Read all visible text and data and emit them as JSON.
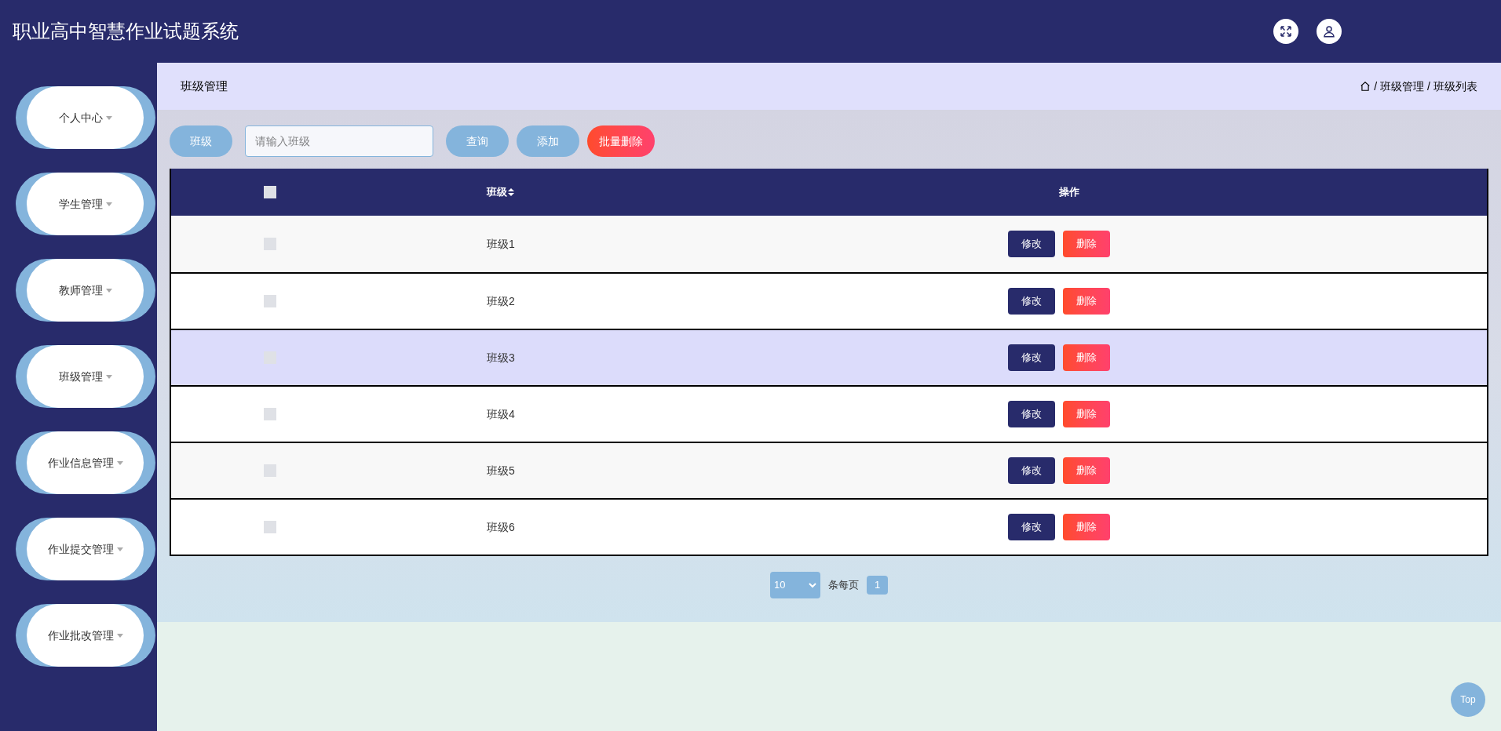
{
  "header": {
    "title": "职业高中智慧作业试题系统"
  },
  "sidebar": {
    "items": [
      {
        "label": "个人中心"
      },
      {
        "label": "学生管理"
      },
      {
        "label": "教师管理"
      },
      {
        "label": "班级管理"
      },
      {
        "label": "作业信息管理"
      },
      {
        "label": "作业提交管理"
      },
      {
        "label": "作业批改管理"
      }
    ]
  },
  "page_title": "班级管理",
  "breadcrumb": [
    {
      "separator": "/",
      "label": "班级管理"
    },
    {
      "separator": "/",
      "label": "班级列表"
    }
  ],
  "toolbar": {
    "field_label": "班级",
    "search": {
      "placeholder": "请输入班级"
    },
    "buttons": [
      {
        "label": "查询",
        "kind": "primary"
      },
      {
        "label": "添加",
        "kind": "primary"
      },
      {
        "label": "批量删除",
        "kind": "danger"
      }
    ]
  },
  "table": {
    "select_all_checked": false,
    "columns": [
      "班级",
      "操作"
    ],
    "rows": [
      {
        "name": "班级1",
        "checked": false,
        "selected": false,
        "actions": [
          "修改",
          "删除"
        ]
      },
      {
        "name": "班级2",
        "checked": false,
        "selected": false,
        "actions": [
          "修改",
          "删除"
        ]
      },
      {
        "name": "班级3",
        "checked": false,
        "selected": true,
        "actions": [
          "修改",
          "删除"
        ]
      },
      {
        "name": "班级4",
        "checked": false,
        "selected": false,
        "actions": [
          "修改",
          "删除"
        ]
      },
      {
        "name": "班级5",
        "checked": false,
        "selected": false,
        "actions": [
          "修改",
          "删除"
        ]
      },
      {
        "name": "班级6",
        "checked": false,
        "selected": false,
        "actions": [
          "修改",
          "删除"
        ]
      }
    ]
  },
  "pagination": {
    "page_size": "10",
    "per_page_label": "条每页",
    "pages": [
      {
        "label": "1",
        "selected": true
      }
    ]
  },
  "top_button": "Top"
}
